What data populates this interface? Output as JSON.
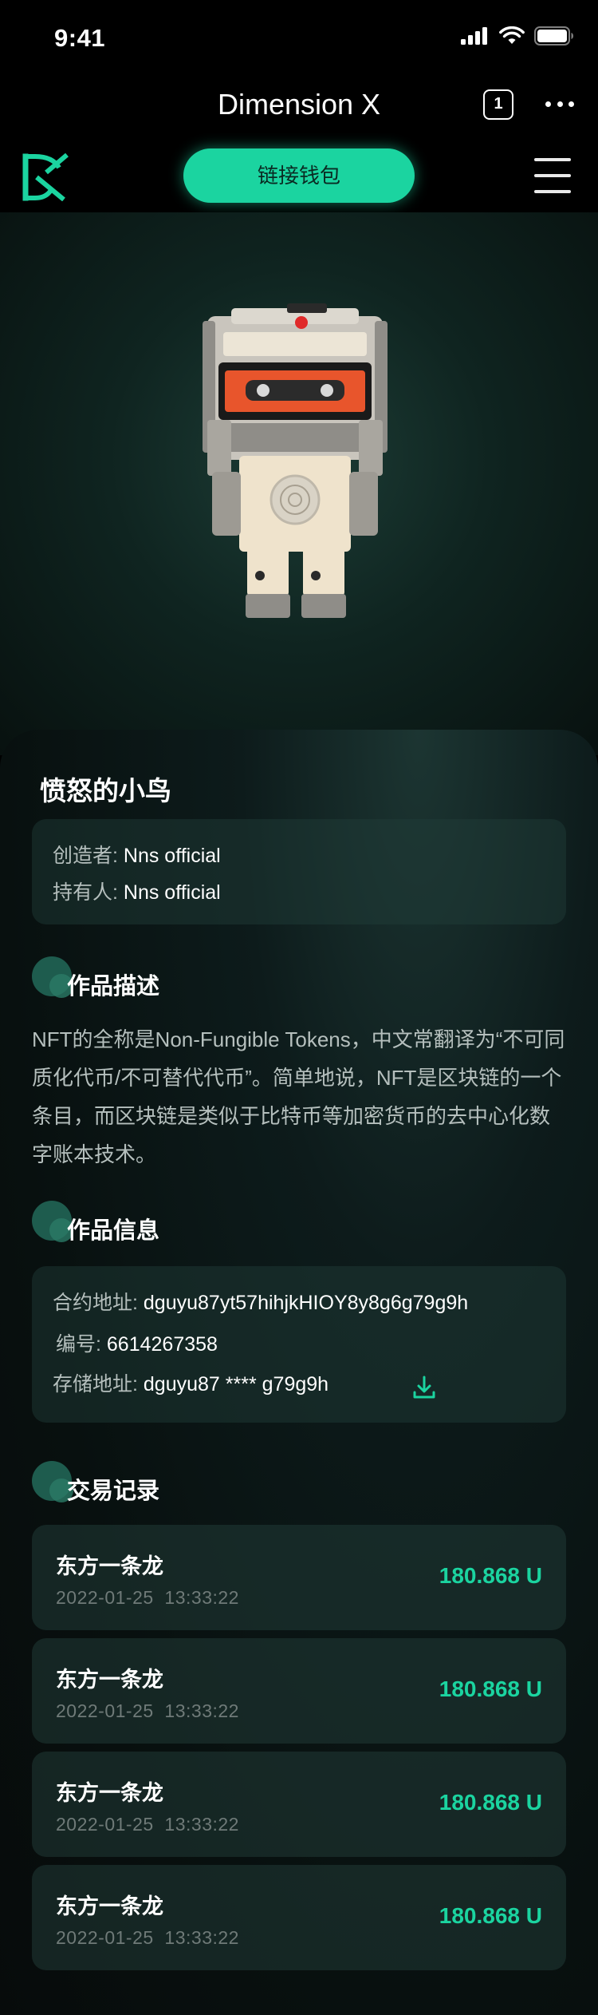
{
  "status_bar": {
    "time": "9:41"
  },
  "title_bar": {
    "title": "Dimension X",
    "tab_count": "1"
  },
  "header": {
    "connect_label": "链接钱包"
  },
  "nft": {
    "title": "愤怒的小鸟",
    "creator_key": "创造者: ",
    "creator_value": "Nns official",
    "owner_key": "持有人: ",
    "owner_value": "Nns official"
  },
  "description": {
    "heading": "作品描述",
    "text": "NFT的全称是Non-Fungible Tokens，中文常翻译为“不可同质化代币/不可替代代币”。简单地说，NFT是区块链的一个条目，而区块链是类似于比特币等加密货币的去中心化数字账本技术。"
  },
  "info": {
    "heading": "作品信息",
    "contract_key": "合约地址: ",
    "contract_value": "dguyu87yt57hihjkHIOY8y8g6g79g9h",
    "number_key": "编号: ",
    "number_value": "6614267358",
    "storage_key": "存储地址: ",
    "storage_value": "dguyu87 **** g79g9h",
    "download_icon": "download-icon"
  },
  "transactions": {
    "heading": "交易记录",
    "items": [
      {
        "name": "东方一条龙",
        "date": "2022-01-25  13:33:22",
        "amount": "180.868 U"
      },
      {
        "name": "东方一条龙",
        "date": "2022-01-25  13:33:22",
        "amount": "180.868 U"
      },
      {
        "name": "东方一条龙",
        "date": "2022-01-25  13:33:22",
        "amount": "180.868 U"
      },
      {
        "name": "东方一条龙",
        "date": "2022-01-25  13:33:22",
        "amount": "180.868 U"
      }
    ]
  },
  "colors": {
    "accent": "#1bd4a0",
    "background": "#000000",
    "card": "#1f3a36"
  }
}
